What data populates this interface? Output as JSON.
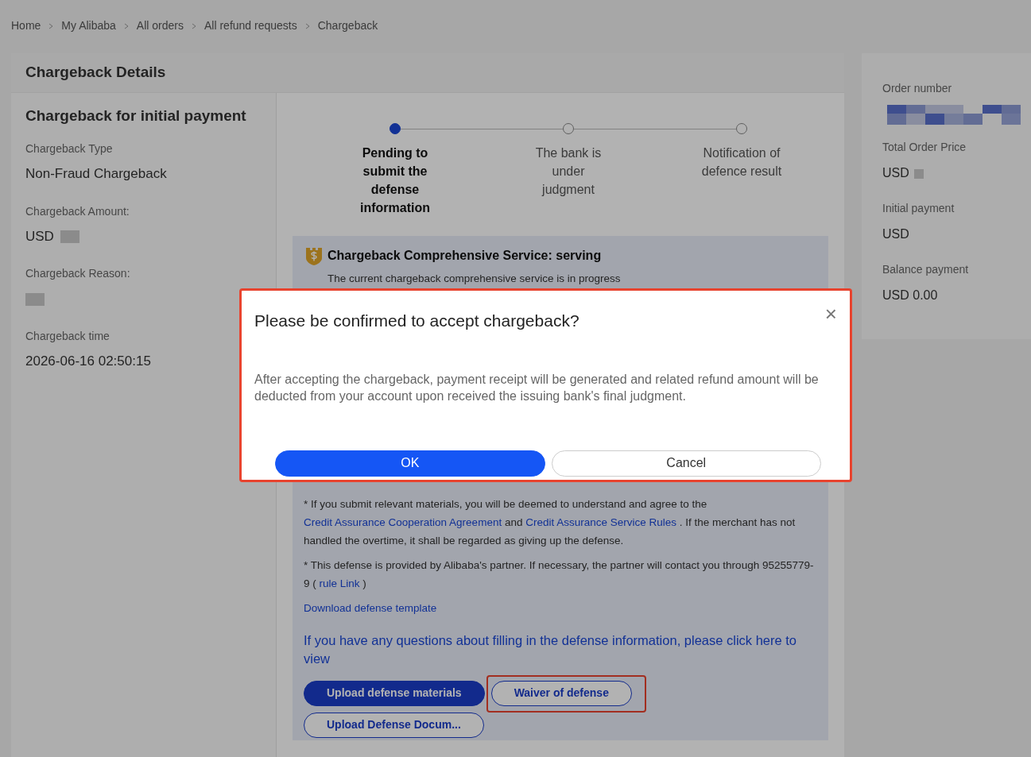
{
  "breadcrumb": [
    {
      "label": "Home"
    },
    {
      "label": "My Alibaba"
    },
    {
      "label": "All orders"
    },
    {
      "label": "All refund requests"
    },
    {
      "label": "Chargeback"
    }
  ],
  "panel_title": "Chargeback Details",
  "summary": {
    "title": "Chargeback for initial payment",
    "fields": [
      {
        "label": "Chargeback Type",
        "value": "Non-Fraud Chargeback",
        "redacted": false
      },
      {
        "label": "Chargeback Amount:",
        "value": "USD",
        "redacted": true
      },
      {
        "label": "Chargeback Reason:",
        "redacted": true
      },
      {
        "label": "Chargeback time",
        "value": "2026-06-16 02:50:15",
        "redacted": false
      }
    ]
  },
  "steps": [
    {
      "label": "Pending to submit the defense information",
      "selected": true
    },
    {
      "label": "The bank is under judgment",
      "selected": false
    },
    {
      "label": "Notification of defence result",
      "selected": false
    }
  ],
  "service": {
    "title": "Chargeback Comprehensive Service:  serving",
    "description": "The current chargeback comprehensive service is in progress",
    "notes": [
      [
        {
          "kind": "text",
          "text": "* If you submit relevant materials, you will be deemed to understand and agree to the "
        },
        {
          "kind": "link",
          "text": "Credit Assurance Cooperation Agreement"
        },
        {
          "kind": "text",
          "text": " and "
        },
        {
          "kind": "link",
          "text": "Credit Assurance Service Rules"
        },
        {
          "kind": "text",
          "text": " . If the merchant has not handled the overtime, it shall be regarded as giving up the defense."
        }
      ],
      [
        {
          "kind": "text",
          "text": "* This defense is provided by Alibaba's partner. If necessary, the partner will contact you through 95255779-9 ( "
        },
        {
          "kind": "link",
          "text": "rule Link"
        },
        {
          "kind": "text",
          "text": " )"
        }
      ]
    ],
    "template_link": "Download defense template",
    "help_link": "If you have any questions about filling in the defense information, please click here to view",
    "buttons": [
      {
        "label": "Upload defense materials",
        "kind": "primary",
        "highlighted": false
      },
      {
        "label": "Waiver of defense",
        "kind": "outline",
        "highlighted": true
      },
      {
        "label": "Upload Defense Docum...",
        "kind": "outline",
        "highlighted": false
      }
    ]
  },
  "order": [
    {
      "label": "Order number",
      "redacted": true,
      "kind": "link"
    },
    {
      "label": "Total Order Price",
      "value": "USD",
      "redacted": true,
      "kind": "text"
    },
    {
      "label": "Initial payment",
      "value": "USD",
      "redacted": false,
      "kind": "text"
    },
    {
      "label": "Balance payment",
      "value": "USD 0.00",
      "redacted": false,
      "kind": "text"
    }
  ],
  "dialog": {
    "title": "Please be confirmed to accept chargeback?",
    "close": "×",
    "message": "After accepting the chargeback, payment receipt will be generated and related refund amount will be deducted from your account upon received the issuing bank's final judgment.",
    "highlighted": true,
    "buttons": [
      {
        "label": "OK",
        "kind": "primary"
      },
      {
        "label": "Cancel",
        "kind": "outline"
      }
    ]
  }
}
